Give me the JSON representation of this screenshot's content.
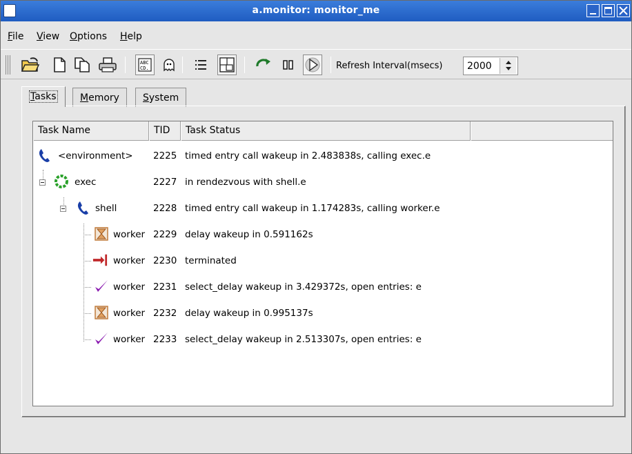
{
  "window": {
    "title": "a.monitor: monitor_me"
  },
  "menu": [
    {
      "label": "File",
      "mnemonic": "F",
      "rest": "ile"
    },
    {
      "label": "View",
      "mnemonic": "V",
      "rest": "iew"
    },
    {
      "label": "Options",
      "mnemonic": "O",
      "rest": "ptions"
    },
    {
      "label": "Help",
      "mnemonic": "H",
      "rest": "elp"
    }
  ],
  "toolbar": {
    "icons": [
      "open-folder-icon",
      "new-file-icon",
      "copy-icon",
      "print-icon",
      "font-icon",
      "ghost-icon",
      "list-view-icon",
      "window-icon",
      "refresh-icon",
      "pause-icon",
      "play-icon"
    ],
    "refresh_label": "Refresh Interval(msecs)",
    "refresh_value": "2000"
  },
  "tabs": [
    {
      "label": "Tasks",
      "mnemonic": "T",
      "rest": "asks",
      "active": true
    },
    {
      "label": "Memory",
      "mnemonic": "M",
      "rest": "emory",
      "active": false
    },
    {
      "label": "System",
      "mnemonic": "S",
      "rest": "ystem",
      "active": false
    }
  ],
  "columns": [
    "Task Name",
    "TID",
    "Task Status"
  ],
  "rows": [
    {
      "name": "<environment>",
      "tid": "2225",
      "status": "timed entry call wakeup in 2.483838s, calling exec.e",
      "icon": "phone-icon",
      "depth": 0
    },
    {
      "name": "exec",
      "tid": "2227",
      "status": "in rendezvous with shell.e",
      "icon": "gear-icon",
      "depth": 0
    },
    {
      "name": "shell",
      "tid": "2228",
      "status": "timed entry call wakeup in 1.174283s, calling worker.e",
      "icon": "phone-icon",
      "depth": 1
    },
    {
      "name": "worker",
      "tid": "2229",
      "status": "delay wakeup in 0.591162s",
      "icon": "hourglass-icon",
      "depth": 2
    },
    {
      "name": "worker",
      "tid": "2230",
      "status": "terminated",
      "icon": "terminated-arrow-icon",
      "depth": 2
    },
    {
      "name": "worker",
      "tid": "2231",
      "status": "select_delay wakeup in 3.429372s, open entries: e",
      "icon": "checkmark-icon",
      "depth": 2
    },
    {
      "name": "worker",
      "tid": "2232",
      "status": "delay wakeup in 0.995137s",
      "icon": "hourglass-icon",
      "depth": 2
    },
    {
      "name": "worker",
      "tid": "2233",
      "status": "select_delay wakeup in 2.513307s, open entries: e",
      "icon": "checkmark-icon",
      "depth": 2
    }
  ],
  "colors": {
    "titlebar": "#2a64c8",
    "phone": "#1a3fa8",
    "gear": "#2aa12a",
    "terminated": "#c0282a",
    "check": "#8a1ab0",
    "hourglass": "#c07a3a"
  }
}
